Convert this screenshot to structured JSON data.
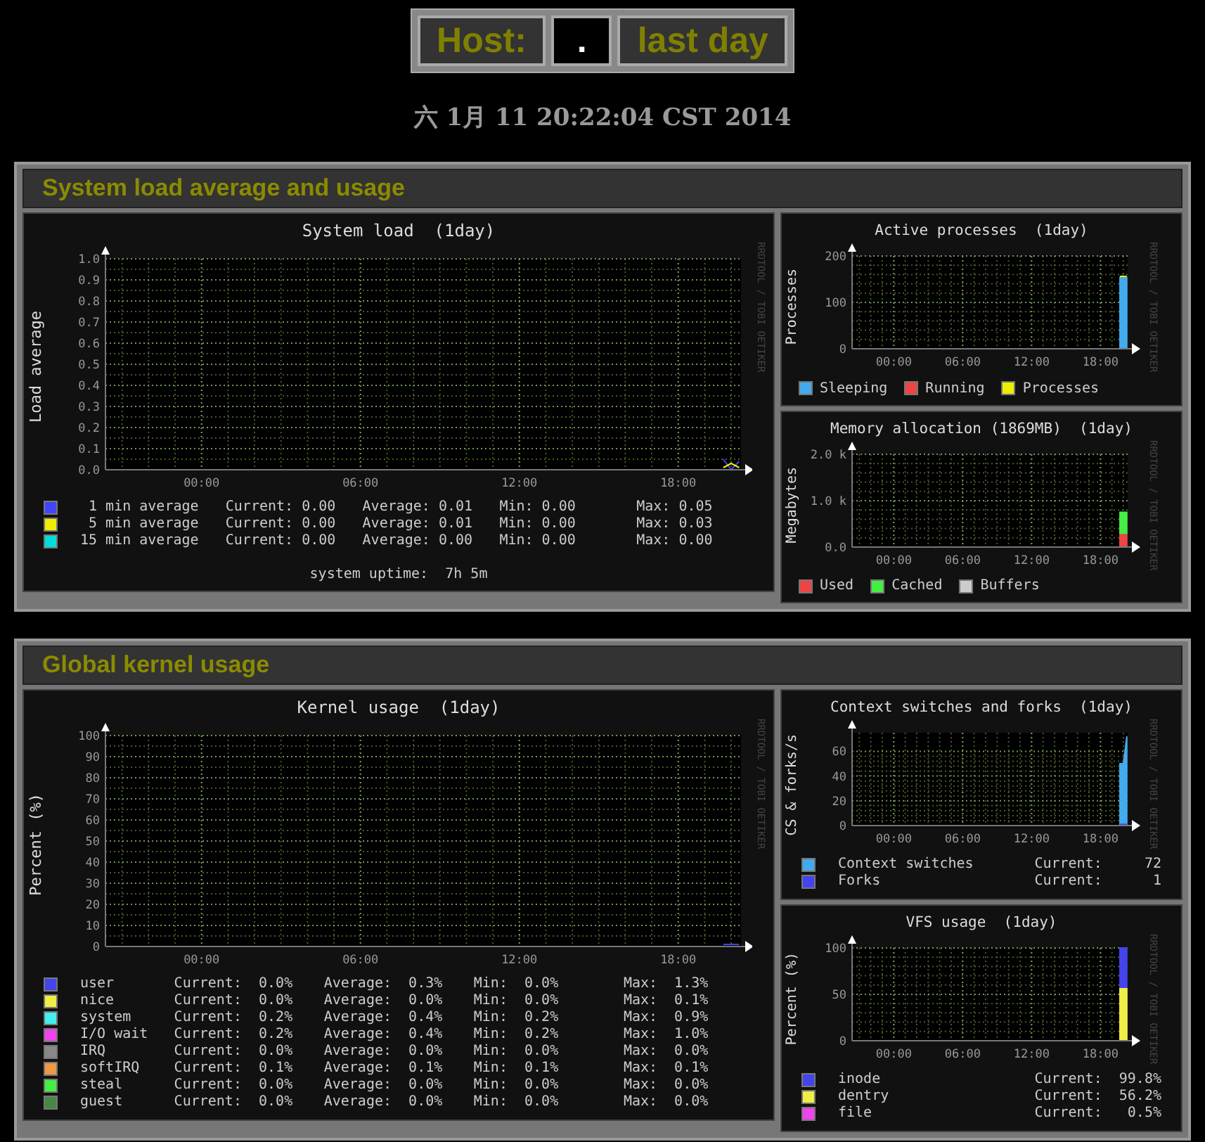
{
  "header": {
    "label": "Host:",
    "host": ".",
    "period": "last day"
  },
  "timestamp": "六 1月 11 20:22:04 CST 2014",
  "sections": [
    {
      "title": "System load average and usage",
      "graphs": [
        {
          "kind": "large",
          "watermark": "RRDTOOL / TOBI OETIKER",
          "footer": "system uptime:  7h 5m",
          "legend": [
            {
              "stats": [
                "Current: 0.00",
                "Average: 0.01",
                "Min: 0.00",
                "Max: 0.05"
              ]
            },
            {
              "stats": [
                "Current: 0.00",
                "Average: 0.01",
                "Min: 0.00",
                "Max: 0.03"
              ]
            },
            {
              "stats": [
                "Current: 0.00",
                "Average: 0.00",
                "Min: 0.00",
                "Max: 0.00"
              ]
            }
          ],
          "chart_data": {
            "type": "line",
            "grid": true,
            "title": "System load  (1day)",
            "ylabel": "Load average",
            "x": [
              19.7,
              20.0,
              20.3
            ],
            "xlim": [
              -3.63,
              20.37
            ],
            "ylim": [
              0,
              1
            ],
            "xticks": [
              {
                "value": 0,
                "label": "00:00"
              },
              {
                "value": 6,
                "label": "06:00"
              },
              {
                "value": 12,
                "label": "12:00"
              },
              {
                "value": 18,
                "label": "18:00"
              }
            ],
            "yticks": [
              {
                "value": 0,
                "label": "0.0"
              },
              {
                "value": 0.1,
                "label": "0.1"
              },
              {
                "value": 0.2,
                "label": "0.2"
              },
              {
                "value": 0.3,
                "label": "0.3"
              },
              {
                "value": 0.4,
                "label": "0.4"
              },
              {
                "value": 0.5,
                "label": "0.5"
              },
              {
                "value": 0.6,
                "label": "0.6"
              },
              {
                "value": 0.7,
                "label": "0.7"
              },
              {
                "value": 0.8,
                "label": "0.8"
              },
              {
                "value": 0.9,
                "label": "0.9"
              },
              {
                "value": 1,
                "label": "1.0"
              }
            ],
            "series": [
              {
                "name": " 1 min average",
                "color": "#4444ff",
                "values": [
                  0.05,
                  0.0,
                  0.04
                ]
              },
              {
                "name": " 5 min average",
                "color": "#eeee00",
                "values": [
                  0.01,
                  0.03,
                  0.01
                ]
              },
              {
                "name": "15 min average",
                "color": "#00dddd",
                "values": [
                  null,
                  null,
                  null
                ]
              }
            ]
          }
        },
        {
          "kind": "small",
          "watermark": "RRDTOOL / TOBI OETIKER",
          "chart_data": {
            "type": "area",
            "stacked": true,
            "grid": true,
            "title": "Active processes  (1day)",
            "ylabel": "Processes",
            "x": [
              19.7,
              20.0,
              20.3
            ],
            "xlim": [
              -3.63,
              20.37
            ],
            "ylim": [
              0,
              200
            ],
            "xticks": [
              {
                "value": 0,
                "label": "00:00"
              },
              {
                "value": 6,
                "label": "06:00"
              },
              {
                "value": 12,
                "label": "12:00"
              },
              {
                "value": 18,
                "label": "18:00"
              }
            ],
            "yticks": [
              {
                "value": 0,
                "label": "0"
              },
              {
                "value": 100,
                "label": "100"
              },
              {
                "value": 200,
                "label": "200"
              }
            ],
            "series": [
              {
                "name": "Sleeping",
                "color": "#44aaee",
                "values": [
                  154,
                  154,
                  154
                ]
              },
              {
                "name": "Running",
                "color": "#ee4444",
                "type": "line",
                "values": [
                  null,
                  null,
                  null
                ]
              },
              {
                "name": "Processes",
                "color": "#eeee00",
                "type": "line",
                "values": [
                  156,
                  156,
                  156
                ]
              }
            ]
          }
        },
        {
          "kind": "small",
          "watermark": "RRDTOOL / TOBI OETIKER",
          "chart_data": {
            "type": "area",
            "stacked": true,
            "grid": true,
            "title": "Memory allocation (1869MB)  (1day)",
            "ylabel": "Megabytes",
            "x": [
              19.7,
              20.0,
              20.3
            ],
            "xlim": [
              -3.63,
              20.37
            ],
            "ylim": [
              0,
              2000
            ],
            "xticks": [
              {
                "value": 0,
                "label": "00:00"
              },
              {
                "value": 6,
                "label": "06:00"
              },
              {
                "value": 12,
                "label": "12:00"
              },
              {
                "value": 18,
                "label": "18:00"
              }
            ],
            "yticks": [
              {
                "value": 0,
                "label": "0.0"
              },
              {
                "value": 1000,
                "label": "1.0 k"
              },
              {
                "value": 2000,
                "label": "2.0 k"
              }
            ],
            "series": [
              {
                "name": "Used",
                "color": "#ee4444",
                "values": [
                  300,
                  300,
                  300
                ]
              },
              {
                "name": "Cached",
                "color": "#44ee44",
                "values": [
                  450,
                  450,
                  450
                ]
              },
              {
                "name": "Buffers",
                "color": "#cccccc",
                "values": [
                  null,
                  null,
                  null
                ]
              }
            ]
          }
        }
      ]
    },
    {
      "title": "Global kernel usage",
      "graphs": [
        {
          "kind": "large",
          "watermark": "RRDTOOL / TOBI OETIKER",
          "legend": [
            {
              "stats": [
                "Current:  0.0%",
                "Average:  0.3%",
                "Min:  0.0%",
                "Max:  1.3%"
              ]
            },
            {
              "stats": [
                "Current:  0.0%",
                "Average:  0.0%",
                "Min:  0.0%",
                "Max:  0.1%"
              ]
            },
            {
              "stats": [
                "Current:  0.2%",
                "Average:  0.4%",
                "Min:  0.2%",
                "Max:  0.9%"
              ]
            },
            {
              "stats": [
                "Current:  0.2%",
                "Average:  0.4%",
                "Min:  0.2%",
                "Max:  1.0%"
              ]
            },
            {
              "stats": [
                "Current:  0.0%",
                "Average:  0.0%",
                "Min:  0.0%",
                "Max:  0.0%"
              ]
            },
            {
              "stats": [
                "Current:  0.1%",
                "Average:  0.1%",
                "Min:  0.1%",
                "Max:  0.1%"
              ]
            },
            {
              "stats": [
                "Current:  0.0%",
                "Average:  0.0%",
                "Min:  0.0%",
                "Max:  0.0%"
              ]
            },
            {
              "stats": [
                "Current:  0.0%",
                "Average:  0.0%",
                "Min:  0.0%",
                "Max:  0.0%"
              ]
            }
          ],
          "chart_data": {
            "type": "line",
            "grid": true,
            "title": "Kernel usage  (1day)",
            "ylabel": "Percent (%)",
            "x": [
              19.7,
              20.0,
              20.3
            ],
            "xlim": [
              -3.63,
              20.37
            ],
            "ylim": [
              0,
              100
            ],
            "xticks": [
              {
                "value": 0,
                "label": "00:00"
              },
              {
                "value": 6,
                "label": "06:00"
              },
              {
                "value": 12,
                "label": "12:00"
              },
              {
                "value": 18,
                "label": "18:00"
              }
            ],
            "yticks": [
              {
                "value": 0,
                "label": "0"
              },
              {
                "value": 10,
                "label": "10"
              },
              {
                "value": 20,
                "label": "20"
              },
              {
                "value": 30,
                "label": "30"
              },
              {
                "value": 40,
                "label": "40"
              },
              {
                "value": 50,
                "label": "50"
              },
              {
                "value": 60,
                "label": "60"
              },
              {
                "value": 70,
                "label": "70"
              },
              {
                "value": 80,
                "label": "80"
              },
              {
                "value": 90,
                "label": "90"
              },
              {
                "value": 100,
                "label": "100"
              }
            ],
            "series": [
              {
                "name": "user",
                "color": "#4444ee",
                "values": [
                  1,
                  1,
                  1
                ]
              },
              {
                "name": "nice",
                "color": "#eeee44",
                "values": [
                  null,
                  null,
                  null
                ]
              },
              {
                "name": "system",
                "color": "#44eeee",
                "values": [
                  null,
                  null,
                  null
                ]
              },
              {
                "name": "I/O wait",
                "color": "#ee44ee",
                "values": [
                  null,
                  null,
                  null
                ]
              },
              {
                "name": "IRQ",
                "color": "#888888",
                "values": [
                  null,
                  null,
                  null
                ]
              },
              {
                "name": "softIRQ",
                "color": "#ee9944",
                "values": [
                  null,
                  null,
                  null
                ]
              },
              {
                "name": "steal",
                "color": "#44ee44",
                "values": [
                  null,
                  null,
                  null
                ]
              },
              {
                "name": "guest",
                "color": "#448844",
                "values": [
                  null,
                  null,
                  null
                ]
              }
            ]
          }
        },
        {
          "kind": "small",
          "watermark": "RRDTOOL / TOBI OETIKER",
          "legend": [
            {
              "stats": [
                "Current:     72"
              ]
            },
            {
              "stats": [
                "Current:      1"
              ]
            }
          ],
          "chart_data": {
            "type": "area",
            "grid": true,
            "title": "Context switches and forks  (1day)",
            "ylabel": "CS & forks/s",
            "x": [
              19.7,
              20.0,
              20.3
            ],
            "xlim": [
              -3.63,
              20.37
            ],
            "ylim": [
              0,
              75
            ],
            "xticks": [
              {
                "value": 0,
                "label": "00:00"
              },
              {
                "value": 6,
                "label": "06:00"
              },
              {
                "value": 12,
                "label": "12:00"
              },
              {
                "value": 18,
                "label": "18:00"
              }
            ],
            "yticks": [
              {
                "value": 0,
                "label": "0"
              },
              {
                "value": 20,
                "label": "20"
              },
              {
                "value": 40,
                "label": "40"
              },
              {
                "value": 60,
                "label": "60"
              }
            ],
            "series": [
              {
                "name": "Context switches",
                "color": "#44aaee",
                "values": [
                  50,
                  50,
                  72
                ]
              },
              {
                "name": "Forks",
                "color": "#4444ee",
                "type": "line",
                "values": [
                  1,
                  1,
                  1
                ]
              }
            ]
          }
        },
        {
          "kind": "small",
          "watermark": "RRDTOOL / TOBI OETIKER",
          "legend": [
            {
              "stats": [
                "Current:  99.8%"
              ]
            },
            {
              "stats": [
                "Current:  56.2%"
              ]
            },
            {
              "stats": [
                "Current:   0.5%"
              ]
            }
          ],
          "chart_data": {
            "type": "area",
            "grid": true,
            "title": "VFS usage  (1day)",
            "ylabel": "Percent (%)",
            "x": [
              19.7,
              20.0,
              20.3
            ],
            "xlim": [
              -3.63,
              20.37
            ],
            "ylim": [
              0,
              100
            ],
            "xticks": [
              {
                "value": 0,
                "label": "00:00"
              },
              {
                "value": 6,
                "label": "06:00"
              },
              {
                "value": 12,
                "label": "12:00"
              },
              {
                "value": 18,
                "label": "18:00"
              }
            ],
            "yticks": [
              {
                "value": 0,
                "label": "0"
              },
              {
                "value": 50,
                "label": "50"
              },
              {
                "value": 100,
                "label": "100"
              }
            ],
            "series": [
              {
                "name": "inode",
                "color": "#4444ee",
                "values": [
                  100,
                  100,
                  100
                ]
              },
              {
                "name": "dentry",
                "color": "#eeee44",
                "values": [
                  56,
                  56,
                  56
                ]
              },
              {
                "name": "file",
                "color": "#ee44ee",
                "type": "line",
                "values": [
                  null,
                  null,
                  null
                ]
              }
            ]
          }
        }
      ]
    }
  ]
}
